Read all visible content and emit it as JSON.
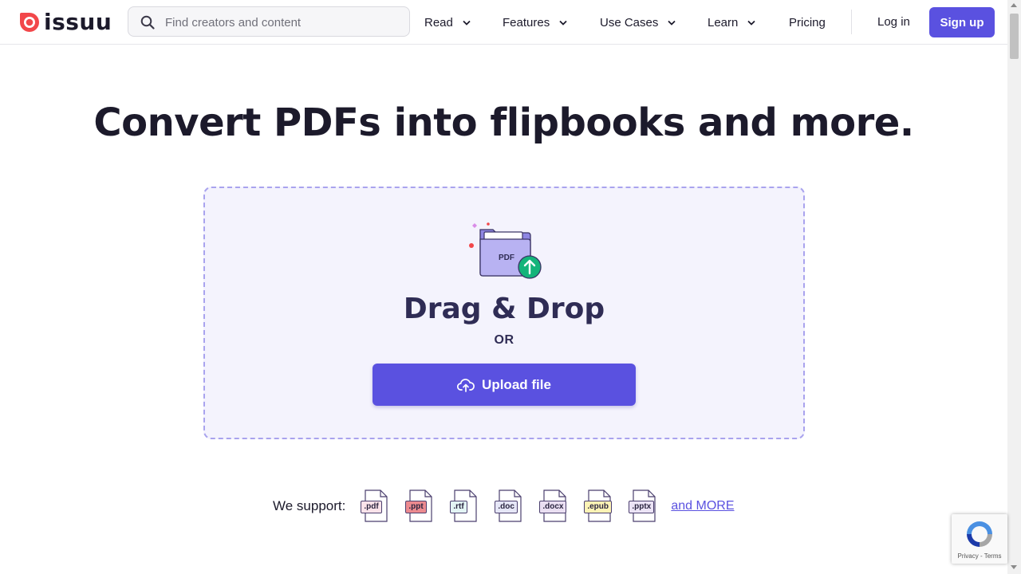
{
  "header": {
    "logo_text": "issuu",
    "search_placeholder": "Find creators and content",
    "nav": [
      {
        "label": "Read"
      },
      {
        "label": "Features"
      },
      {
        "label": "Use Cases"
      },
      {
        "label": "Learn"
      }
    ],
    "pricing_label": "Pricing",
    "login_label": "Log in",
    "signup_label": "Sign up"
  },
  "hero": {
    "title": "Convert PDFs into flipbooks and more."
  },
  "dropzone": {
    "folder_label": "PDF",
    "title": "Drag & Drop",
    "or_label": "OR",
    "upload_label": "Upload file"
  },
  "support": {
    "label": "We support:",
    "formats": [
      {
        "ext": ".pdf",
        "color": "#fbe3ea"
      },
      {
        "ext": ".ppt",
        "color": "#ec8a8f"
      },
      {
        "ext": ".rtf",
        "color": "#e3f4f4"
      },
      {
        "ext": ".doc",
        "color": "#e6e7f7"
      },
      {
        "ext": ".docx",
        "color": "#eadff2"
      },
      {
        "ext": ".epub",
        "color": "#fdf3b5"
      },
      {
        "ext": ".pptx",
        "color": "#ece4f6"
      }
    ],
    "more_label": "and MORE"
  },
  "recaptcha": {
    "terms": "Privacy - Terms"
  },
  "colors": {
    "brand": "#5a51e0",
    "logo_red": "#f2474a",
    "dropzone_bg": "#f4f3fd",
    "upload_green": "#14b47a"
  }
}
